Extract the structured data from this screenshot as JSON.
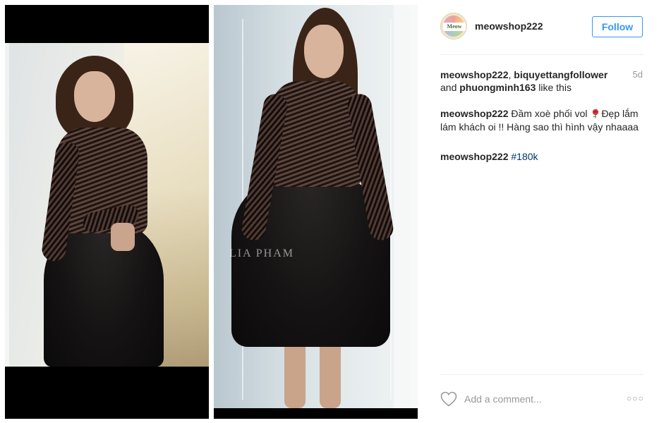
{
  "post": {
    "photo_left": {
      "alt": "model in black lace dress, left photo"
    },
    "photo_right": {
      "alt": "model in black lace dress, right photo",
      "watermark": "LIA PHAM"
    }
  },
  "header": {
    "username": "meowshop222",
    "avatar_text": "Meow",
    "follow_label": "Follow"
  },
  "likes": {
    "users": [
      "meowshop222",
      "biquyettangfollower",
      "phuongminh163"
    ],
    "sep1": ", ",
    "sep2": " and ",
    "suffix": " like this",
    "time": "5d"
  },
  "comments": [
    {
      "user": "meowshop222",
      "text_before_emoji": " Đầm xoè phối vol ",
      "emoji": "rose-icon",
      "text_after_emoji": "Đẹp lắm lám khách oi !! Hàng sao thì hình vậy nhaaaa"
    },
    {
      "user": "meowshop222",
      "hashtag": "#180k"
    }
  ],
  "footer": {
    "comment_placeholder": "Add a comment...",
    "more_label": "○○○"
  },
  "colors": {
    "link_blue": "#3897f0",
    "hashtag": "#003569",
    "muted": "#999999",
    "text": "#262626"
  }
}
